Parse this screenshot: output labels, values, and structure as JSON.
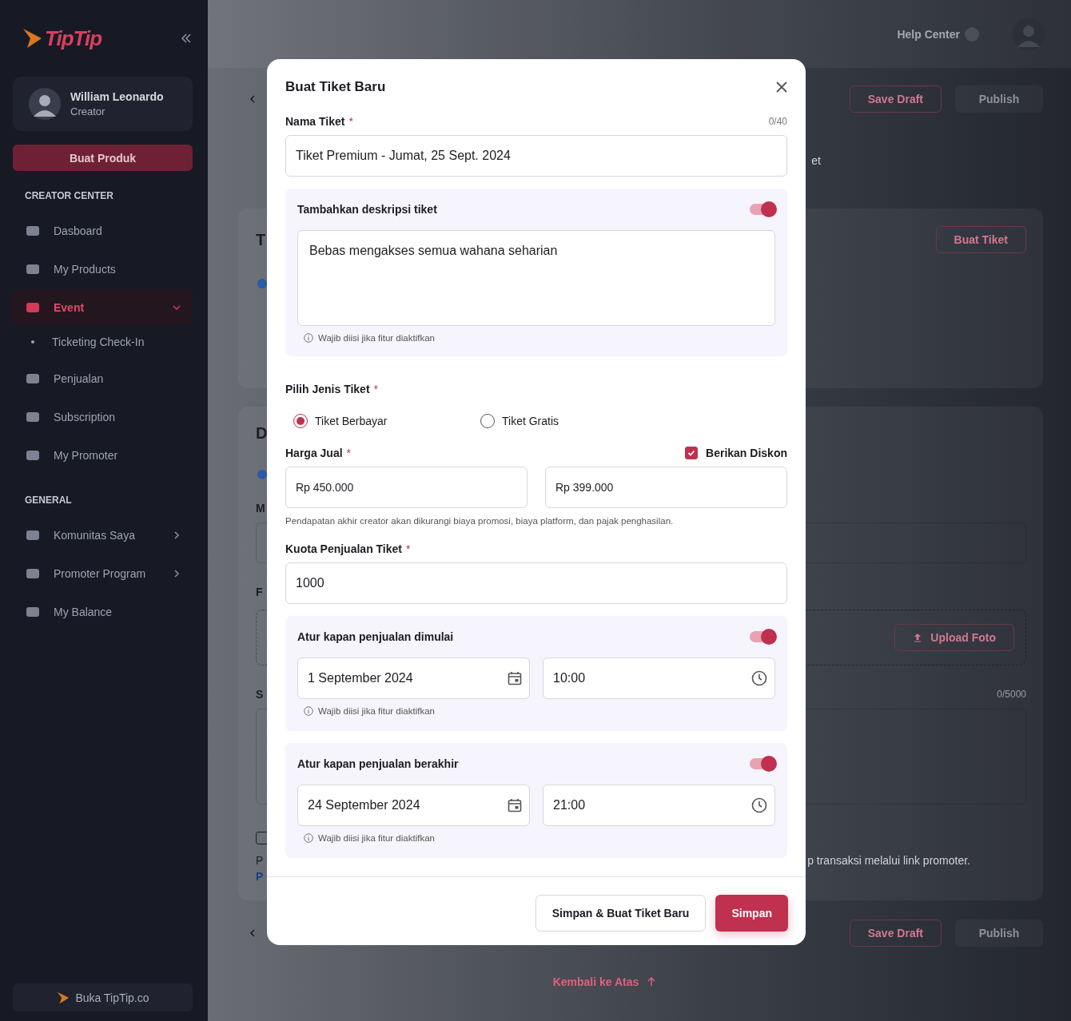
{
  "sidebar": {
    "logo": "TipTip",
    "user": {
      "name": "William Leonardo",
      "role": "Creator"
    },
    "create_button": "Buat Produk",
    "sections": [
      {
        "title": "CREATOR CENTER",
        "items": [
          {
            "label": "Dasboard",
            "kind": "link",
            "selected": false
          },
          {
            "label": "My Products",
            "kind": "link",
            "selected": false
          },
          {
            "label": "Event",
            "kind": "menu",
            "selected": true,
            "expanded": true,
            "children": [
              {
                "label": "Ticketing Check-In",
                "selected": false
              }
            ]
          },
          {
            "label": "Penjualan",
            "kind": "link",
            "selected": false
          },
          {
            "label": "Subscription",
            "kind": "link",
            "selected": false
          },
          {
            "label": "My Promoter",
            "kind": "link",
            "selected": false
          }
        ]
      },
      {
        "title": "GENERAL",
        "items": [
          {
            "label": "Komunitas Saya",
            "kind": "menu",
            "selected": false,
            "expanded": false
          },
          {
            "label": "Promoter Program",
            "kind": "menu",
            "selected": false,
            "expanded": false
          },
          {
            "label": "My Balance",
            "kind": "link",
            "selected": false
          }
        ]
      }
    ],
    "footer_button": "Buka TipTip.co"
  },
  "topbar": {
    "help": "Help Center"
  },
  "page": {
    "top_actions": [
      {
        "label": "Save Draft",
        "kind": "outline"
      },
      {
        "label": "Publish",
        "kind": "disabled"
      }
    ],
    "side_text": "et",
    "card_1": {
      "heading": "T",
      "button": "Buat Tiket"
    },
    "card_2": {
      "heading": "D",
      "field_label": "M",
      "photo_label": "F",
      "upload_button": "Upload Foto",
      "text_label": "S",
      "counter": "0/5000",
      "checkbox": {
        "checked": false
      },
      "promoter_start": "P",
      "promoter_end": "p transaksi melalui link promoter.",
      "link": "P"
    },
    "bottom_actions": [
      {
        "label": "Save Draft",
        "kind": "outline"
      },
      {
        "label": "Publish",
        "kind": "disabled"
      }
    ],
    "back_to_top": "Kembali ke Atas"
  },
  "modal": {
    "title": "Buat Tiket Baru",
    "name_field": {
      "label": "Nama Tiket",
      "required_mark": "*",
      "counter": "0/40",
      "value": "Tiket Premium - Jumat, 25 Sept. 2024"
    },
    "description": {
      "label": "Tambahkan deskripsi tiket",
      "on": true,
      "value": "Bebas mengakses semua wahana seharian",
      "hint": "Wajib diisi jika fitur diaktifkan"
    },
    "ticket_type": {
      "label": "Pilih Jenis Tiket",
      "required_mark": "*",
      "options": [
        {
          "label": "Tiket Berbayar",
          "selected": true
        },
        {
          "label": "Tiket Gratis",
          "selected": false
        }
      ]
    },
    "price": {
      "label": "Harga Jual",
      "required_mark": "*",
      "discount": {
        "label": "Berikan Diskon",
        "checked": true
      },
      "value": "Rp 450.000",
      "discount_value": "Rp 399.000",
      "note": "Pendapatan akhir creator akan dikurangi biaya promosi, biaya platform, dan pajak penghasilan."
    },
    "quota": {
      "label": "Kuota Penjualan Tiket",
      "required_mark": "*",
      "value": "1000"
    },
    "schedules": [
      {
        "label": "Atur kapan penjualan dimulai",
        "on": true,
        "date": "1 September 2024",
        "time": "10:00",
        "hint": "Wajib diisi jika fitur diaktifkan"
      },
      {
        "label": "Atur kapan penjualan berakhir",
        "on": true,
        "date": "24 September 2024",
        "time": "21:00",
        "hint": "Wajib diisi jika fitur diaktifkan"
      }
    ],
    "buttons": [
      {
        "label": "Simpan & Buat Tiket Baru",
        "kind": "secondary"
      },
      {
        "label": "Simpan",
        "kind": "primary"
      }
    ]
  }
}
